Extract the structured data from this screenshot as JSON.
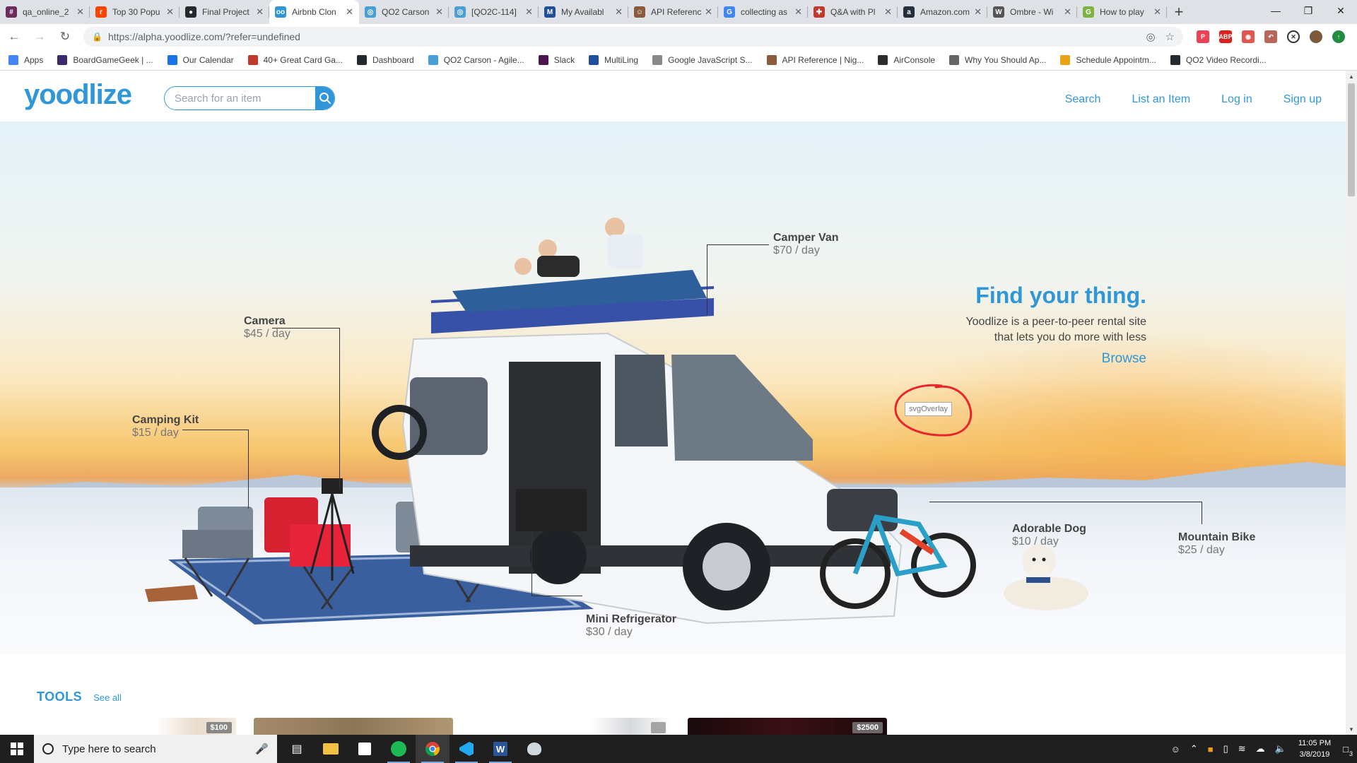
{
  "browser": {
    "tabs": [
      {
        "title": "qa_online_2",
        "color": "#6a2c5e",
        "glyph": "#",
        "active": false
      },
      {
        "title": "Top 30 Popu",
        "color": "#ff4500",
        "glyph": "r",
        "active": false
      },
      {
        "title": "Final Project",
        "color": "#24292e",
        "glyph": "●",
        "active": false
      },
      {
        "title": "Airbnb Clon",
        "color": "#2f97d8",
        "glyph": "oo",
        "active": true
      },
      {
        "title": "QO2 Carson",
        "color": "#4a9fd8",
        "glyph": "◎",
        "active": false
      },
      {
        "title": "[QO2C-114]",
        "color": "#4a9fd8",
        "glyph": "◎",
        "active": false
      },
      {
        "title": "My Availabl",
        "color": "#1f4e9c",
        "glyph": "M",
        "active": false
      },
      {
        "title": "API Referenc",
        "color": "#8a5a3a",
        "glyph": "☺",
        "active": false
      },
      {
        "title": "collecting as",
        "color": "#4285f4",
        "glyph": "G",
        "active": false
      },
      {
        "title": "Q&A with Pl",
        "color": "#c0392b",
        "glyph": "✚",
        "active": false
      },
      {
        "title": "Amazon.com",
        "color": "#232f3e",
        "glyph": "a",
        "active": false
      },
      {
        "title": "Ombre - Wi",
        "color": "#555555",
        "glyph": "W",
        "active": false
      },
      {
        "title": "How to play",
        "color": "#7cb342",
        "glyph": "G",
        "active": false
      }
    ],
    "url": "https://alpha.yoodlize.com/?refer=undefined",
    "bookmarks": [
      {
        "label": "Apps",
        "color": "#4285f4"
      },
      {
        "label": "BoardGameGeek | ...",
        "color": "#3b2a6a"
      },
      {
        "label": "Our Calendar",
        "color": "#1a73e8"
      },
      {
        "label": "40+ Great Card Ga...",
        "color": "#c0392b"
      },
      {
        "label": "Dashboard",
        "color": "#24292e"
      },
      {
        "label": "QO2 Carson - Agile...",
        "color": "#4a9fd8"
      },
      {
        "label": "Slack",
        "color": "#4a154b"
      },
      {
        "label": "MultiLing",
        "color": "#1f4e9c"
      },
      {
        "label": "Google JavaScript S...",
        "color": "#888888"
      },
      {
        "label": "API Reference | Nig...",
        "color": "#8a5a3a"
      },
      {
        "label": "AirConsole",
        "color": "#2c2c2c"
      },
      {
        "label": "Why You Should Ap...",
        "color": "#666666"
      },
      {
        "label": "Schedule Appointm...",
        "color": "#e8a317"
      },
      {
        "label": "QO2 Video Recordi...",
        "color": "#24292e"
      }
    ]
  },
  "site": {
    "logo": "yoodlize",
    "search_placeholder": "Search for an item",
    "nav": [
      "Search",
      "List an Item",
      "Log in",
      "Sign up"
    ],
    "brand_color": "#2f97d8"
  },
  "hero": {
    "headline": "Find your thing.",
    "tagline_line1": "Yoodlize is a peer-to-peer rental site",
    "tagline_line2": "that lets you do more with less",
    "browse": "Browse",
    "tooltip": "svgOverlay",
    "callouts": {
      "camper_van": {
        "name": "Camper Van",
        "price": "$70 / day"
      },
      "camera": {
        "name": "Camera",
        "price": "$45 / day"
      },
      "camping_kit": {
        "name": "Camping Kit",
        "price": "$15 / day"
      },
      "mini_fridge": {
        "name": "Mini Refrigerator",
        "price": "$30 / day"
      },
      "dog": {
        "name": "Adorable Dog",
        "price": "$10 / day"
      },
      "bike": {
        "name": "Mountain Bike",
        "price": "$25 / day"
      }
    }
  },
  "tools": {
    "title": "TOOLS",
    "see_all": "See all",
    "price_1": "$100",
    "price_4": "$2500"
  },
  "taskbar": {
    "search_placeholder": "Type here to search",
    "time": "11:05 PM",
    "date": "3/8/2019",
    "notifications": "3"
  }
}
